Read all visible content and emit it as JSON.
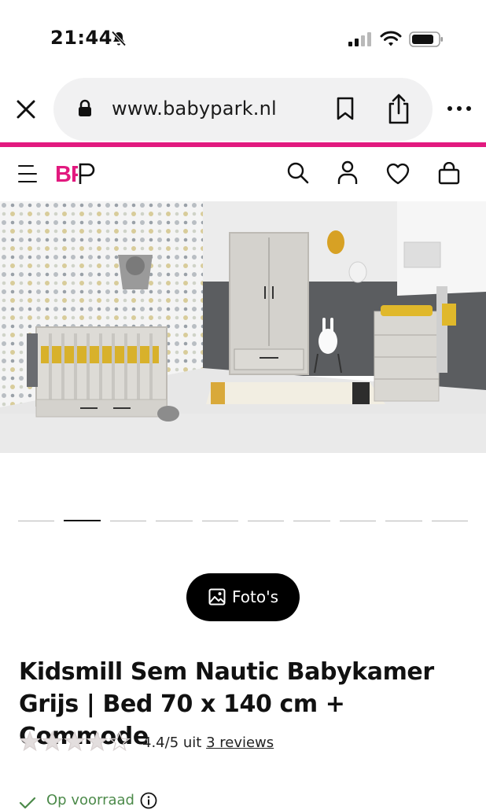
{
  "status_bar": {
    "time": "21:44"
  },
  "browser": {
    "url": "www.babypark.nl"
  },
  "site": {
    "logo_text": "BP",
    "brand_color": "#e2197f"
  },
  "icons": {
    "status": [
      "bell-slash-icon",
      "cellular-signal-icon",
      "wifi-icon",
      "battery-icon"
    ],
    "browser": [
      "close-icon",
      "lock-icon",
      "bookmark-icon",
      "share-icon",
      "more-icon"
    ],
    "header": [
      "hamburger-menu-icon",
      "search-icon",
      "user-icon",
      "heart-icon",
      "bag-icon"
    ]
  },
  "carousel": {
    "total": 10,
    "active_index": 1
  },
  "photos_button": {
    "label": "Foto's"
  },
  "product": {
    "title": "Kidsmill Sem Nautic Babykamer Grijs | Bed 70 x 140 cm + Commode",
    "rating_value": 4.4,
    "rating_text": "4.4/5 uit",
    "reviews_link": "3  reviews",
    "stock_text": "Op voorraad"
  }
}
